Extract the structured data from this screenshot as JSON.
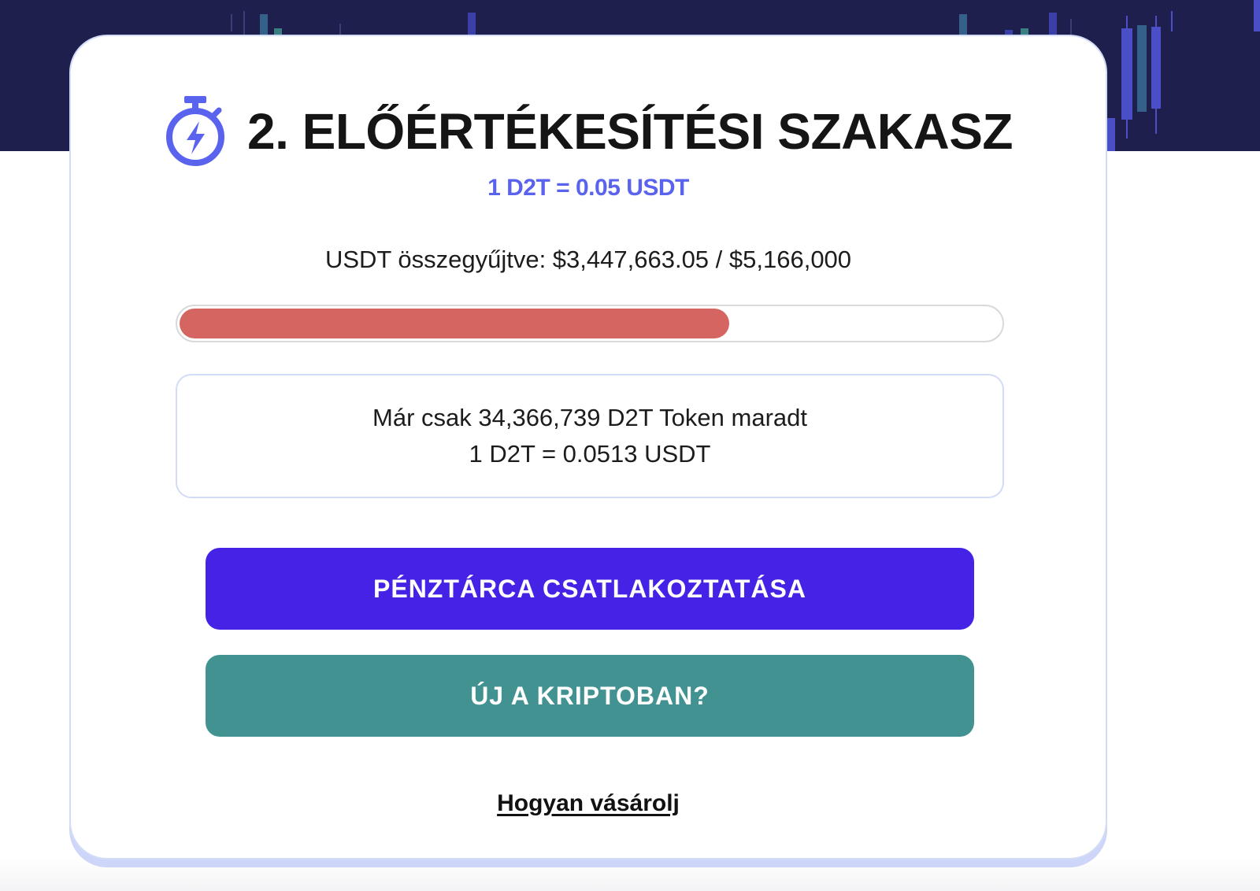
{
  "presale": {
    "stage_title": "2. ELŐÉRTÉKESÍTÉSI SZAKASZ",
    "stage_price": "1 D2T = 0.05 USDT",
    "raised_text": "USDT összegyűjtve: $3,447,663.05 / $5,166,000",
    "progress_percent": 67,
    "remaining_text": "Már csak 34,366,739 D2T Token maradt",
    "next_price_text": "1 D2T = 0.0513 USDT"
  },
  "actions": {
    "connect_wallet_label": "PÉNZTÁRCA CSATLAKOZTATÁSA",
    "new_to_crypto_label": "ÚJ A KRIPTOBAN?",
    "how_to_buy_label": "Hogyan vásárolj"
  },
  "icons": {
    "stage_icon": "stopwatch-lightning-icon"
  },
  "colors": {
    "hero_background": "#1f1f4e",
    "accent_blue": "#5a63ee",
    "progress_fill": "#d46560",
    "connect_button": "#4622e6",
    "new_to_crypto_button": "#429292"
  }
}
